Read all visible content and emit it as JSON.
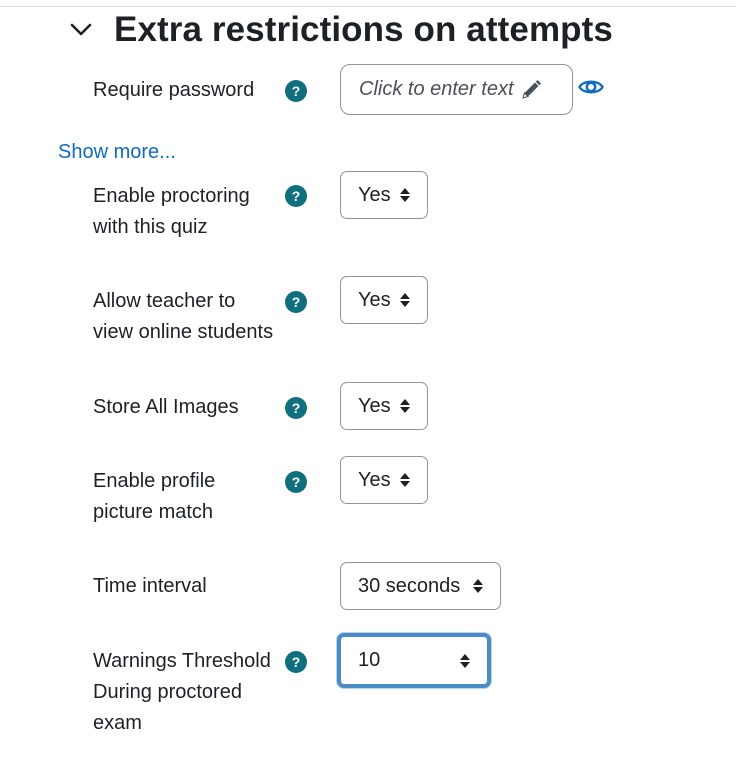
{
  "section": {
    "title": "Extra restrictions on attempts",
    "toggle_icon": "chevron-down-icon"
  },
  "password": {
    "label": "Require password",
    "value": "Click to enter text",
    "edit_icon": "pencil-icon",
    "reveal_icon": "eye-icon"
  },
  "show_more": "Show more...",
  "help_glyph": "?",
  "fields": {
    "proctoring": {
      "label_lines": [
        "Enable proctoring",
        "with this quiz"
      ],
      "value": "Yes"
    },
    "teacher_view": {
      "label_lines": [
        "Allow teacher to",
        "view online students"
      ],
      "value": "Yes"
    },
    "store_images": {
      "label_lines": [
        "Store All Images"
      ],
      "value": "Yes"
    },
    "profile_match": {
      "label_lines": [
        "Enable profile",
        "picture match"
      ],
      "value": "Yes"
    },
    "time_interval": {
      "label_lines": [
        "Time interval"
      ],
      "value": "30 seconds"
    },
    "warnings_threshold": {
      "label_lines": [
        "Warnings Threshold",
        "During proctored",
        "exam"
      ],
      "value": "10"
    }
  },
  "colors": {
    "help_icon": "#0f6f7f",
    "link": "#0f6cbf",
    "focus_ring": "#4a8bc8"
  }
}
